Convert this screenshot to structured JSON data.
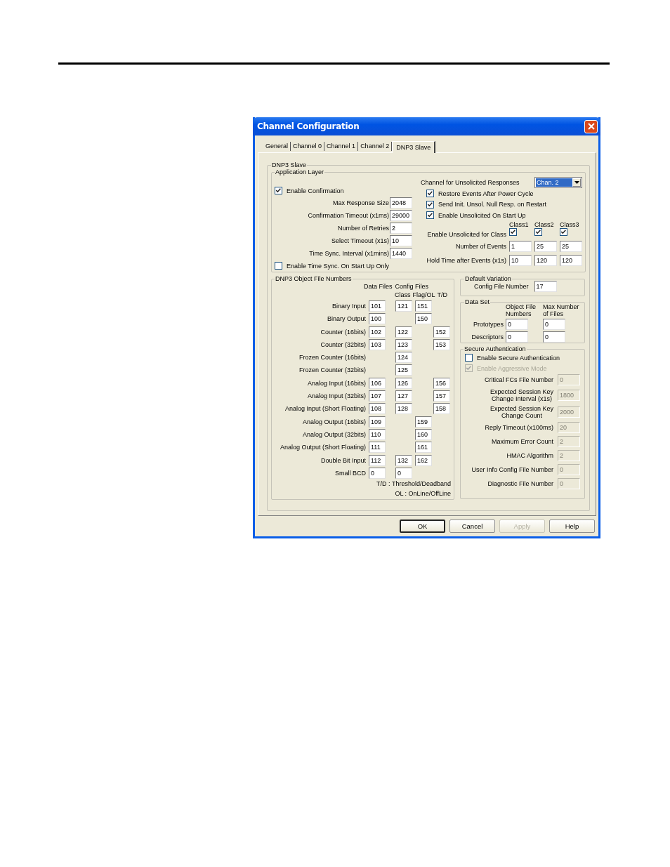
{
  "window": {
    "title": "Channel Configuration"
  },
  "tabs": [
    {
      "label": "General",
      "selected": false
    },
    {
      "label": "Channel 0",
      "selected": false
    },
    {
      "label": "Channel 1",
      "selected": false
    },
    {
      "label": "Channel 2",
      "selected": false
    },
    {
      "label": "DNP3 Slave",
      "selected": true
    }
  ],
  "dnp3_slave": {
    "title": "DNP3 Slave",
    "application_layer": {
      "title": "Application Layer",
      "enable_confirmation": {
        "label": "Enable Confirmation",
        "checked": true
      },
      "fields": [
        {
          "label": "Max Response Size",
          "value": "2048"
        },
        {
          "label": "Confirmation Timeout (x1ms)",
          "value": "29000"
        },
        {
          "label": "Number of Retries",
          "value": "2"
        },
        {
          "label": "Select Timeout (x1s)",
          "value": "10"
        },
        {
          "label": "Time Sync. Interval (x1mins)",
          "value": "1440"
        }
      ],
      "enable_time_sync": {
        "label": "Enable Time Sync. On Start Up Only",
        "checked": false
      },
      "unsolicited_channel": {
        "label": "Channel for Unsolicited Responses",
        "value": "Chan. 2"
      },
      "options": [
        {
          "label": "Restore Events  After Power Cycle",
          "checked": true
        },
        {
          "label": "Send Init. Unsol. Null Resp. on Restart",
          "checked": true
        },
        {
          "label": "Enable Unsolicited On Start Up",
          "checked": true
        }
      ],
      "class_headers": [
        "Class1",
        "Class2",
        "Class3"
      ],
      "enable_unsolicited_for_class": {
        "label": "Enable Unsolicited for Class",
        "classes": [
          {
            "checked": true
          },
          {
            "checked": true
          },
          {
            "checked": true
          }
        ]
      },
      "class_rows": [
        {
          "label": "Number of Events",
          "values": [
            "1",
            "25",
            "25"
          ]
        },
        {
          "label": "Hold Time after Events (x1s)",
          "values": [
            "10",
            "120",
            "120"
          ]
        }
      ]
    },
    "object_file_numbers": {
      "title": "DNP3 Object File Numbers",
      "data_files": "Data Files",
      "config_files": "Config Files",
      "class": "Class",
      "flag_ol": "Flag/OL",
      "td": "T/D",
      "rows": [
        {
          "label": "Binary Input",
          "data": "101",
          "class": "121",
          "flag": "151"
        },
        {
          "label": "Binary Output",
          "data": "100",
          "flag": "150"
        },
        {
          "label": "Counter (16bits)",
          "data": "102",
          "class": "122",
          "td": "152"
        },
        {
          "label": "Counter (32bits)",
          "data": "103",
          "class": "123",
          "td": "153"
        },
        {
          "label": "Frozen Counter (16bits)",
          "class": "124"
        },
        {
          "label": "Frozen Counter (32bits)",
          "class": "125"
        },
        {
          "label": "Analog Input (16bits)",
          "data": "106",
          "class": "126",
          "td": "156"
        },
        {
          "label": "Analog Input (32bits)",
          "data": "107",
          "class": "127",
          "td": "157"
        },
        {
          "label": "Analog Input (Short Floating)",
          "data": "108",
          "class": "128",
          "td": "158"
        },
        {
          "label": "Analog Output (16bits)",
          "data": "109",
          "flag": "159"
        },
        {
          "label": "Analog Output (32bits)",
          "data": "110",
          "flag": "160"
        },
        {
          "label": "Analog Output (Short Floating)",
          "data": "111",
          "flag": "161"
        },
        {
          "label": "Double Bit Input",
          "data": "112",
          "class": "132",
          "flag": "162"
        },
        {
          "label": "Small BCD",
          "data": "0",
          "class": "0"
        }
      ],
      "legend": [
        "T/D : Threshold/Deadband",
        "OL : OnLine/OffLine"
      ]
    },
    "default_variation": {
      "title": "Default Variation",
      "label": "Config File Number",
      "value": "17"
    },
    "data_set": {
      "title": "Data Set",
      "headers": [
        "Object File\nNumbers",
        "Max Number\nof Files"
      ],
      "rows": [
        {
          "label": "Prototypes",
          "values": [
            "0",
            "0"
          ]
        },
        {
          "label": "Descriptors",
          "values": [
            "0",
            "0"
          ]
        }
      ]
    },
    "secure_authentication": {
      "title": "Secure Authentication",
      "enable": {
        "label": "Enable Secure Authentication",
        "checked": false,
        "disabled": false
      },
      "aggressive": {
        "label": "Enable Aggressive Mode",
        "checked": true,
        "disabled": true
      },
      "fields": [
        {
          "label": "Critical FCs File Number",
          "value": "0",
          "disabled": true
        },
        {
          "label": "Expected Session Key\nChange Interval (x1s)",
          "value": "1800",
          "disabled": true
        },
        {
          "label": "Expected Session Key\nChange Count",
          "value": "2000",
          "disabled": true
        },
        {
          "label": "Reply Timeout (x100ms)",
          "value": "20",
          "disabled": true
        },
        {
          "label": "Maximum Error Count",
          "value": "2",
          "disabled": true
        },
        {
          "label": "HMAC Algorithm",
          "value": "2",
          "disabled": true
        },
        {
          "label": "User Info Config File Number",
          "value": "0",
          "disabled": true
        },
        {
          "label": "Diagnostic File Number",
          "value": "0",
          "disabled": true
        }
      ]
    }
  },
  "buttons": [
    {
      "label": "OK",
      "default": true,
      "disabled": false
    },
    {
      "label": "Cancel",
      "default": false,
      "disabled": false
    },
    {
      "label": "Apply",
      "default": false,
      "disabled": true
    },
    {
      "label": "Help",
      "default": false,
      "disabled": false
    }
  ]
}
